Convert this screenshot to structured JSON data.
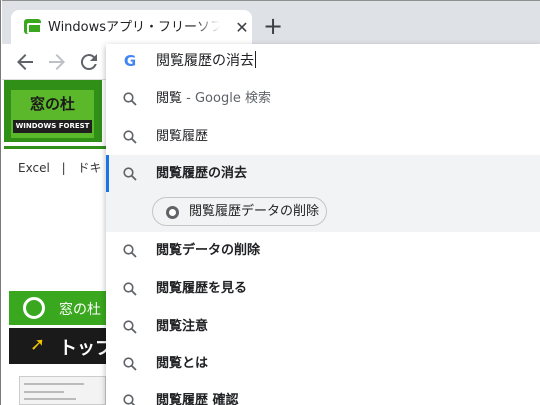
{
  "tab": {
    "title": "Windowsアプリ・フリーソフトのおすすめ",
    "close_glyph": "✕",
    "new_tab_glyph": "+"
  },
  "omnibox": {
    "value": "閲覧履歴の消去"
  },
  "suggestions": [
    {
      "text": "閲覧",
      "suffix": " - Google 検索",
      "bold": false
    },
    {
      "text": "閲覧履歴",
      "suffix": "",
      "bold": false
    },
    {
      "text": "閲覧履歴の消去",
      "suffix": "",
      "bold": true
    },
    {
      "text": "閲覧データの削除",
      "suffix": "",
      "bold": true
    },
    {
      "text": "閲覧履歴を見る",
      "suffix": "",
      "bold": true
    },
    {
      "text": "閲覧注意",
      "suffix": "",
      "bold": true
    },
    {
      "text": "閲覧とは",
      "suffix": "",
      "bold": true
    },
    {
      "text": "閲覧履歴 確認",
      "suffix": "",
      "bold": true
    }
  ],
  "action_chip": {
    "label": "閲覧履歴データの削除"
  },
  "page": {
    "logo_title": "窓の杜",
    "logo_sub": "WINDOWS FOREST",
    "nav_items": [
      "Excel",
      "|",
      "ドキ"
    ],
    "side_box1_label": "窓の杜",
    "side_box2_label": "トップ"
  },
  "colors": {
    "accent": "#1a73e8",
    "brand_green": "#3aa81e",
    "selected_bg": "#f1f3f4"
  }
}
